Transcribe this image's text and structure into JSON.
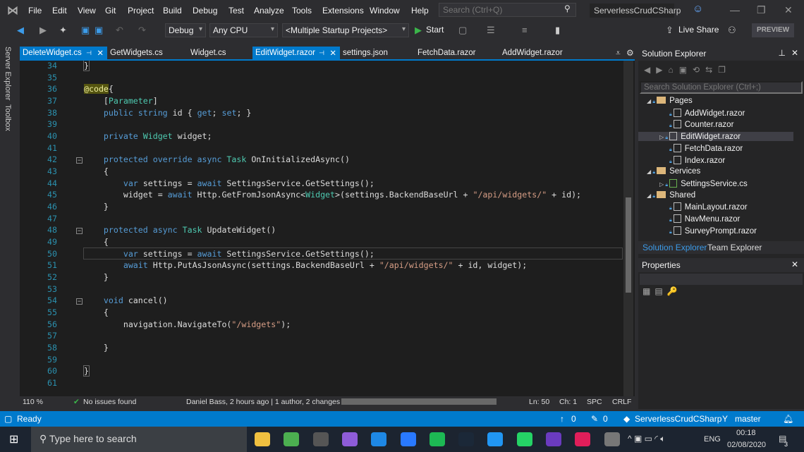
{
  "menu": [
    "File",
    "Edit",
    "View",
    "Git",
    "Project",
    "Build",
    "Debug",
    "Test",
    "Analyze",
    "Tools",
    "Extensions",
    "Window",
    "Help"
  ],
  "search_placeholder": "Search (Ctrl+Q)",
  "solution_title": "ServerlessCrudCSharp",
  "toolbar": {
    "config": "Debug",
    "platform": "Any CPU",
    "startup": "<Multiple Startup Projects>",
    "start": "Start",
    "live_share": "Live Share",
    "preview": "PREVIEW"
  },
  "left_strip": [
    "Server Explorer",
    "Toolbox"
  ],
  "tabs": [
    {
      "label": "DeleteWidget.cs",
      "active": true,
      "pinned": true
    },
    {
      "label": "GetWidgets.cs"
    },
    {
      "label": "Widget.cs"
    },
    {
      "label": "EditWidget.razor",
      "active": true,
      "pinned": true
    },
    {
      "label": "settings.json"
    },
    {
      "label": "FetchData.razor"
    },
    {
      "label": "AddWidget.razor"
    }
  ],
  "code": [
    {
      "n": 34,
      "t": [
        [
          "br",
          "}"
        ]
      ]
    },
    {
      "n": 35,
      "t": []
    },
    {
      "n": 36,
      "t": [
        [
          "at",
          "@code"
        ],
        [
          "",
          "{"
        ]
      ]
    },
    {
      "n": 37,
      "t": [
        [
          "",
          "    ["
        ],
        [
          "ty",
          "Parameter"
        ],
        [
          "",
          "]"
        ]
      ]
    },
    {
      "n": 38,
      "t": [
        [
          "kw",
          "    public string"
        ],
        [
          "",
          " id { "
        ],
        [
          "kw",
          "get"
        ],
        [
          "",
          "; "
        ],
        [
          "kw",
          "set"
        ],
        [
          "",
          "; }"
        ]
      ]
    },
    {
      "n": 39,
      "t": []
    },
    {
      "n": 40,
      "t": [
        [
          "kw",
          "    private "
        ],
        [
          "ty",
          "Widget"
        ],
        [
          "",
          " widget;"
        ]
      ]
    },
    {
      "n": 41,
      "t": []
    },
    {
      "n": 42,
      "t": [
        [
          "kw",
          "    protected override async "
        ],
        [
          "ty",
          "Task"
        ],
        [
          "",
          " OnInitializedAsync()"
        ]
      ],
      "fold": true
    },
    {
      "n": 43,
      "t": [
        [
          "",
          "    {"
        ]
      ]
    },
    {
      "n": 44,
      "t": [
        [
          "kw",
          "        var"
        ],
        [
          "",
          " settings = "
        ],
        [
          "kw",
          "await"
        ],
        [
          "",
          " SettingsService.GetSettings();"
        ]
      ]
    },
    {
      "n": 45,
      "t": [
        [
          "",
          "        widget = "
        ],
        [
          "kw",
          "await"
        ],
        [
          "",
          " Http.GetFromJsonAsync<"
        ],
        [
          "ty",
          "Widget"
        ],
        [
          "",
          ">(settings.BackendBaseUrl + "
        ],
        [
          "st",
          "\"/api/widgets/\""
        ],
        [
          "",
          " + id);"
        ]
      ]
    },
    {
      "n": 46,
      "t": [
        [
          "",
          "    }"
        ]
      ]
    },
    {
      "n": 47,
      "t": []
    },
    {
      "n": 48,
      "t": [
        [
          "kw",
          "    protected async "
        ],
        [
          "ty",
          "Task"
        ],
        [
          "",
          " UpdateWidget()"
        ]
      ],
      "fold": true
    },
    {
      "n": 49,
      "t": [
        [
          "",
          "    {"
        ]
      ]
    },
    {
      "n": 50,
      "t": [
        [
          "kw",
          "        var"
        ],
        [
          "",
          " settings = "
        ],
        [
          "kw",
          "await"
        ],
        [
          "",
          " SettingsService.GetSettings();"
        ]
      ]
    },
    {
      "n": 51,
      "t": [
        [
          "kw",
          "        await"
        ],
        [
          "",
          " Http.PutAsJsonAsync(settings.BackendBaseUrl + "
        ],
        [
          "st",
          "\"/api/widgets/\""
        ],
        [
          "",
          " + id, widget);"
        ]
      ]
    },
    {
      "n": 52,
      "t": [
        [
          "",
          "    }"
        ]
      ]
    },
    {
      "n": 53,
      "t": []
    },
    {
      "n": 54,
      "t": [
        [
          "kw",
          "    void"
        ],
        [
          "",
          " cancel()"
        ]
      ],
      "fold": true
    },
    {
      "n": 55,
      "t": [
        [
          "",
          "    {"
        ]
      ]
    },
    {
      "n": 56,
      "t": [
        [
          "",
          "        navigation.NavigateTo("
        ],
        [
          "st",
          "\"/widgets\""
        ],
        [
          "",
          ");"
        ]
      ]
    },
    {
      "n": 57,
      "t": []
    },
    {
      "n": 58,
      "t": [
        [
          "",
          "    }"
        ]
      ]
    },
    {
      "n": 59,
      "t": []
    },
    {
      "n": 60,
      "t": [
        [
          "br",
          "}"
        ]
      ]
    },
    {
      "n": 61,
      "t": []
    }
  ],
  "editor_bar": {
    "zoom": "110 %",
    "issues": "No issues found",
    "git": "Daniel Bass, 2 hours ago | 1 author, 2 changes",
    "ln": "Ln: 50",
    "ch": "Ch: 1",
    "spc": "SPC",
    "crlf": "CRLF"
  },
  "solution_explorer": {
    "title": "Solution Explorer",
    "search_placeholder": "Search Solution Explorer (Ctrl+;)",
    "items": [
      {
        "label": "Pages",
        "type": "folder",
        "lvl": 0,
        "exp": "open"
      },
      {
        "label": "AddWidget.razor",
        "type": "file",
        "lvl": 1
      },
      {
        "label": "Counter.razor",
        "type": "file",
        "lvl": 1
      },
      {
        "label": "EditWidget.razor",
        "type": "file",
        "lvl": 1,
        "exp": "closed",
        "selected": true
      },
      {
        "label": "FetchData.razor",
        "type": "file",
        "lvl": 1
      },
      {
        "label": "Index.razor",
        "type": "file",
        "lvl": 1
      },
      {
        "label": "Services",
        "type": "folder",
        "lvl": 0,
        "exp": "open"
      },
      {
        "label": "SettingsService.cs",
        "type": "cs",
        "lvl": 1,
        "exp": "closed"
      },
      {
        "label": "Shared",
        "type": "folder",
        "lvl": 0,
        "exp": "open"
      },
      {
        "label": "MainLayout.razor",
        "type": "file",
        "lvl": 1
      },
      {
        "label": "NavMenu.razor",
        "type": "file",
        "lvl": 1
      },
      {
        "label": "SurveyPrompt.razor",
        "type": "file",
        "lvl": 1
      }
    ],
    "tabs": [
      "Solution Explorer",
      "Team Explorer"
    ]
  },
  "properties": {
    "title": "Properties"
  },
  "status": {
    "ready": "Ready",
    "up": "0",
    "edits": "0",
    "repo": "ServerlessCrudCSharp",
    "branch": "master"
  },
  "taskbar": {
    "search_placeholder": "Type here to search",
    "lang": "ENG",
    "time": "00:18",
    "date": "02/08/2020",
    "notifications": "3",
    "apps": [
      {
        "name": "file-explorer",
        "color": "#f0c040"
      },
      {
        "name": "chrome",
        "color": "#4caf50"
      },
      {
        "name": "terminal",
        "color": "#555"
      },
      {
        "name": "visual-studio",
        "color": "#8e5cd9"
      },
      {
        "name": "vs-code",
        "color": "#1e88e5"
      },
      {
        "name": "firefox",
        "color": "#2979ff"
      },
      {
        "name": "spotify",
        "color": "#1db954"
      },
      {
        "name": "steam",
        "color": "#1b2838"
      },
      {
        "name": "p-app",
        "color": "#2196f3"
      },
      {
        "name": "whatsapp",
        "color": "#25d366"
      },
      {
        "name": "visual-studio-2",
        "color": "#6a3bbf"
      },
      {
        "name": "slack",
        "color": "#e01e5a"
      },
      {
        "name": "app",
        "color": "#777"
      }
    ]
  }
}
